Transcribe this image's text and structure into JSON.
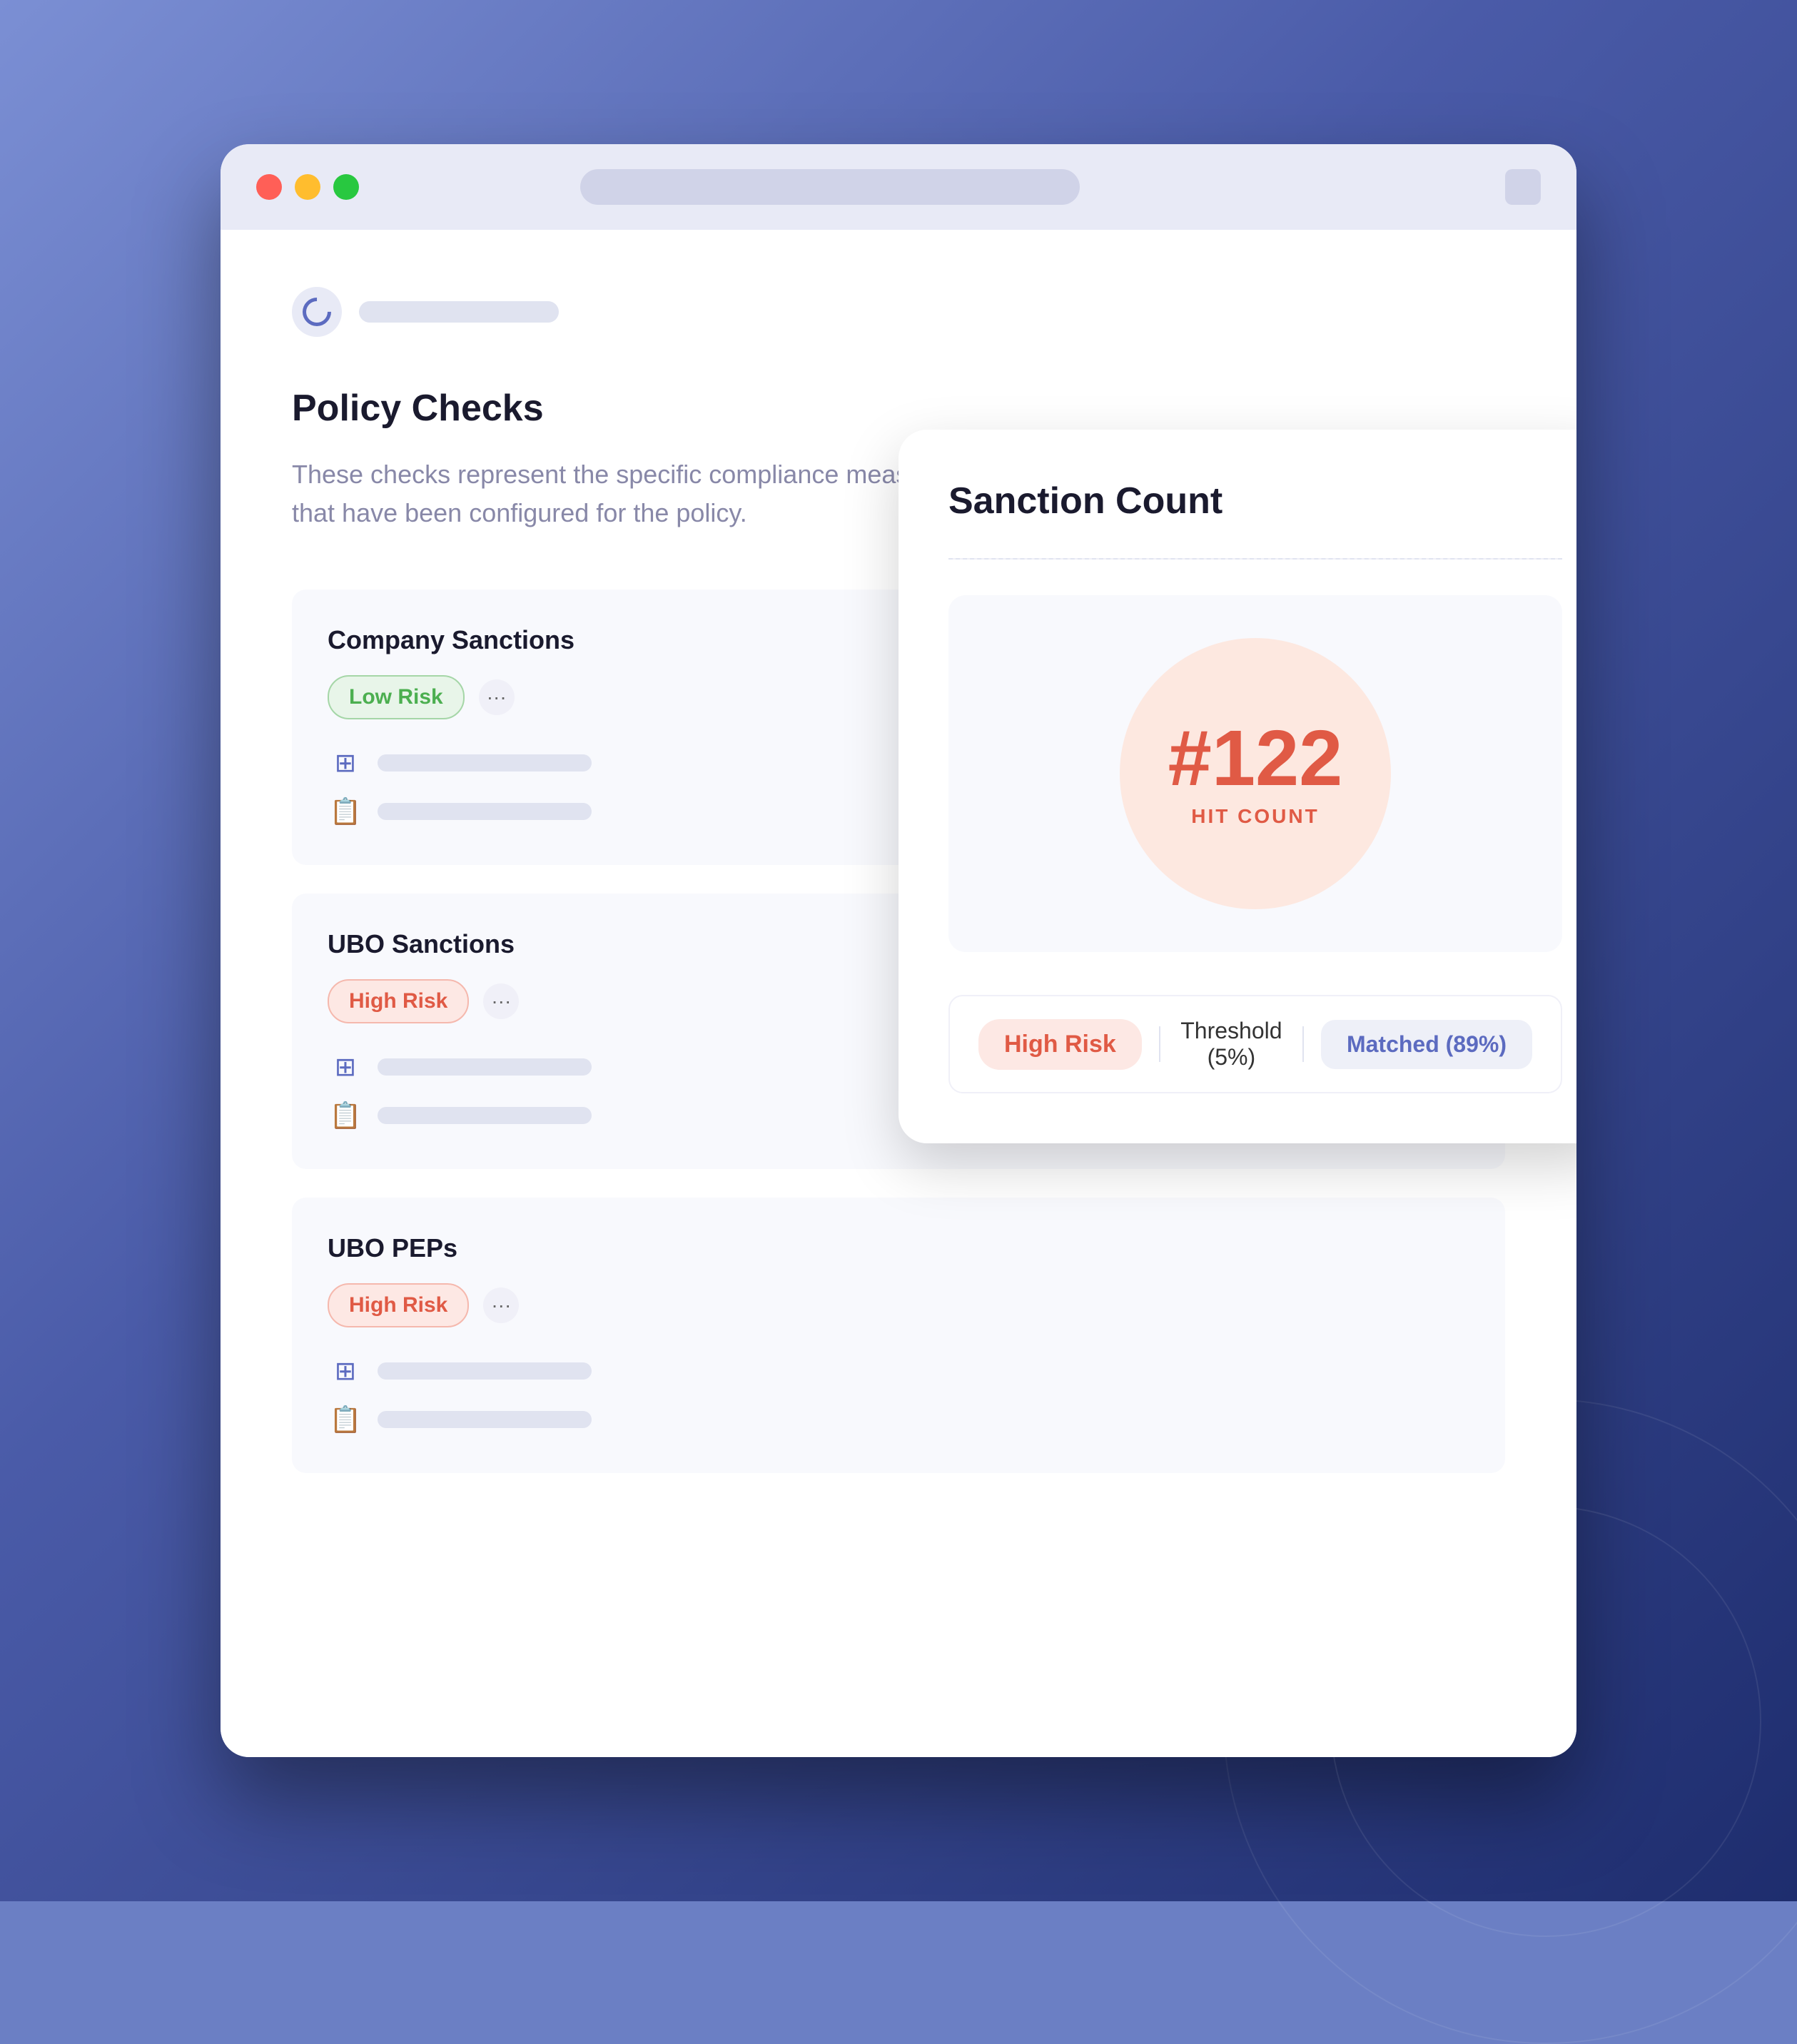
{
  "browser": {
    "titlebar": {
      "traffic_lights": [
        "red",
        "yellow",
        "green"
      ]
    }
  },
  "app": {
    "header_placeholder": ""
  },
  "page": {
    "title": "Policy Checks",
    "description": "These checks represent the specific compliance measures that have been configured for the policy."
  },
  "policy_cards": [
    {
      "id": "company-sanctions",
      "title": "Company Sanctions",
      "badge": "Low Risk",
      "badge_type": "low",
      "dots_label": "···"
    },
    {
      "id": "ubo-sanctions",
      "title": "UBO Sanctions",
      "badge": "High Risk",
      "badge_type": "high",
      "dots_label": "···"
    },
    {
      "id": "ubo-peps",
      "title": "UBO PEPs",
      "badge": "High Risk",
      "badge_type": "high",
      "dots_label": "···"
    }
  ],
  "sanction_card": {
    "title": "Sanction Count",
    "hit_count_number": "#122",
    "hit_count_label": "HIT COUNT",
    "footer": {
      "high_risk_label": "High Risk",
      "threshold_label": "Threshold (5%)",
      "matched_label": "Matched (89%)"
    }
  }
}
